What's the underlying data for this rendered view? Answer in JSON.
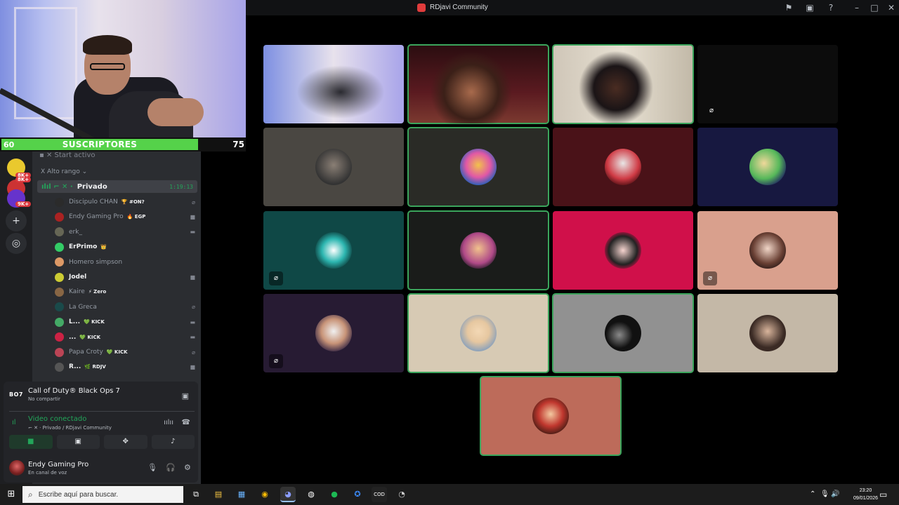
{
  "window": {
    "title": "RDjavi Community"
  },
  "overlay": {
    "subs_left": "60",
    "subs_label": "SUSCRIPTORES",
    "subs_right": "75",
    "sub_progress": 0.8
  },
  "rail": {
    "badges": [
      "8K+",
      "8K+",
      "9K+"
    ]
  },
  "sidebar": {
    "stream_row": "Start activo",
    "category": "Alto rango",
    "voice_channel": {
      "name": "Privado",
      "timer": "1:19:13"
    },
    "members": [
      {
        "name": "Discipulo CHAN",
        "tag": "🏆 #ON?",
        "bold": false,
        "color": "#2b2b2b",
        "status": "mute"
      },
      {
        "name": "Endy Gaming Pro",
        "tag": "🔥 EGP",
        "bold": false,
        "color": "#a22",
        "status": "video"
      },
      {
        "name": "erk_",
        "tag": "",
        "bold": false,
        "color": "#665",
        "status": "live"
      },
      {
        "name": "ErPrimo",
        "tag": "👑",
        "bold": true,
        "color": "#3c6",
        "status": ""
      },
      {
        "name": "Homero simpson",
        "tag": "",
        "bold": false,
        "color": "#d96",
        "status": ""
      },
      {
        "name": "Jodel",
        "tag": "",
        "bold": true,
        "color": "#cc3",
        "status": "video"
      },
      {
        "name": "Kaire",
        "tag": "⚡ Zero",
        "bold": false,
        "color": "#864",
        "status": ""
      },
      {
        "name": "La Greca",
        "tag": "",
        "bold": false,
        "color": "#1a4a4a",
        "status": "mute"
      },
      {
        "name": "L...",
        "tag": "💚 KICK",
        "bold": true,
        "color": "#4a6",
        "status": "live"
      },
      {
        "name": "...",
        "tag": "💚 KICK",
        "bold": true,
        "color": "#c24",
        "status": "live"
      },
      {
        "name": "Papa Croty",
        "tag": "💚 KICK",
        "bold": false,
        "color": "#b45",
        "status": "mute"
      },
      {
        "name": "R...",
        "tag": "🌿 RDJV",
        "bold": true,
        "color": "#555",
        "status": "video"
      }
    ]
  },
  "panel": {
    "game_logo": "BO7",
    "game_title": "Call of Duty® Black Ops 7",
    "game_sub": "No compartir",
    "vc_status": "Video conectado",
    "vc_where": "Privado / RDjavi Community",
    "user_name": "Endy Gaming Pro",
    "user_status": "En canal de voz"
  },
  "taskbar": {
    "search_placeholder": "Escribe aquí para buscar.",
    "time": "23:20",
    "date": "09/01/2026"
  }
}
